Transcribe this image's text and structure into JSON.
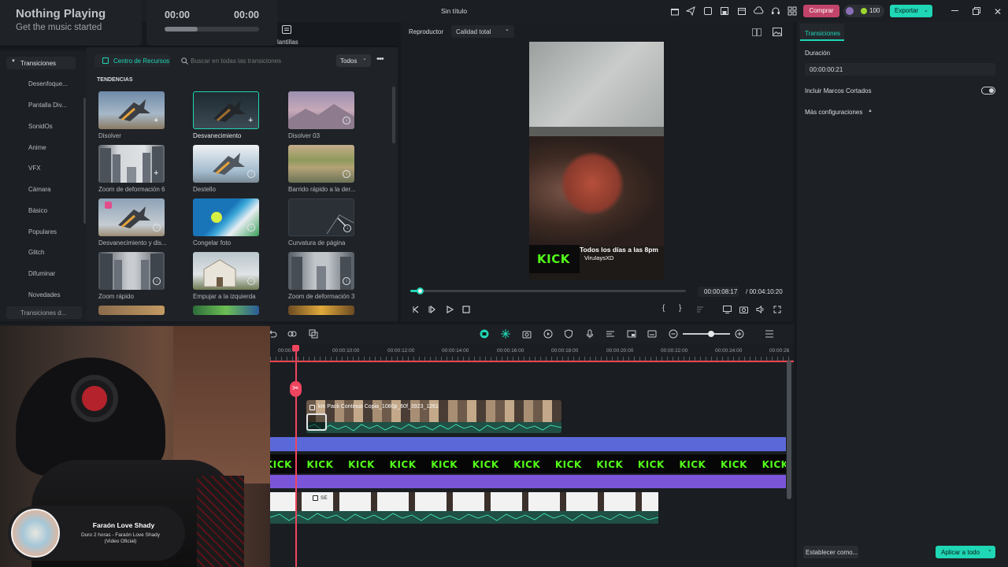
{
  "window": {
    "title": "Sin título",
    "buy_label": "Comprar",
    "credits": "100",
    "export_label": "Exportar"
  },
  "now_playing": {
    "title": "Nothing Playing",
    "subtitle": "Get the music started",
    "time_start": "00:00",
    "time_end": "00:00",
    "progress": 0.35
  },
  "top_tabs": {
    "plantillas": "lantillas"
  },
  "sidebar": {
    "header": "Transiciones",
    "items": [
      "Desenfoque...",
      "Pantalla Div...",
      "SonidOs",
      "Anime",
      "VFX",
      "Cámara",
      "Básico",
      "Populares",
      "Glitch",
      "Difuminar",
      "Novedades"
    ],
    "footer": "Transiciones d..."
  },
  "resources": {
    "tab": "Centro de Recursos",
    "search_placeholder": "Buscar en todas las transiciones",
    "filter": "Todos",
    "section": "TENDENCIAS",
    "items": [
      "Disolver",
      "Desvanecimiento",
      "Disolver 03",
      "Zoom de deformación 6",
      "Destello",
      "Barrido rápido a la der...",
      "Desvanecimiento y dis...",
      "Congelar foto",
      "Curvatura de página",
      "Zoom rápido",
      "Empujar a la izquierda",
      "Zoom de deformación 3"
    ]
  },
  "player": {
    "label": "Reproductor",
    "quality": "Calidad total",
    "overlay_line1": "Todos los días a las 8pm",
    "overlay_line2": "ViruIaysXD",
    "kick": "KICK",
    "current_time": "00:00:08:17",
    "total_time": "/  00:04:10:20",
    "progress": 0.035
  },
  "right_panel": {
    "tab": "Transiciones",
    "duration_label": "Duración",
    "duration_value": "00:00:00:21",
    "include_label": "Incluir Marcos Cortados",
    "more_label": "Más configuraciones",
    "set_as_label": "Establecer como...",
    "apply_all_label": "Aplicar a todo"
  },
  "timeline": {
    "ruler": [
      "00:00:00",
      "00:00:10:00",
      "00:00:12:00",
      "00:00:14:00",
      "00:00:16:00",
      "00:00:18:00",
      "00:00:20:00",
      "00:00:22:00",
      "00:00:24:00",
      "00:00:26"
    ],
    "clip1_name": "km Pack Continuo Copia_1080p_60f_3923_1261",
    "kick_track_label": "KICK",
    "clip3_name": "SE"
  },
  "music_widget": {
    "artist": "Faraón Love Shady",
    "track": "Duro 2 horas - Faraón Love Shady (Video Oficial)"
  },
  "colors": {
    "accent": "#1fd6b5",
    "buy": "#c2446a",
    "kick_green": "#53fc18",
    "playhead": "#f0455f"
  }
}
